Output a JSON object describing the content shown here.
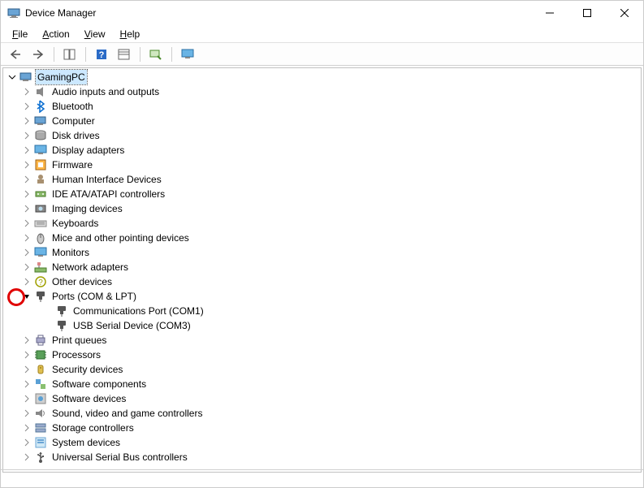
{
  "window": {
    "title": "Device Manager"
  },
  "menu": {
    "file": "File",
    "action": "Action",
    "view": "View",
    "help": "Help"
  },
  "tree": {
    "root": "GamingPC",
    "items": [
      {
        "label": "Audio inputs and outputs",
        "icon": "audio",
        "expanded": false
      },
      {
        "label": "Bluetooth",
        "icon": "bluetooth",
        "expanded": false
      },
      {
        "label": "Computer",
        "icon": "computer",
        "expanded": false
      },
      {
        "label": "Disk drives",
        "icon": "disk",
        "expanded": false
      },
      {
        "label": "Display adapters",
        "icon": "display",
        "expanded": false
      },
      {
        "label": "Firmware",
        "icon": "firmware",
        "expanded": false
      },
      {
        "label": "Human Interface Devices",
        "icon": "hid",
        "expanded": false
      },
      {
        "label": "IDE ATA/ATAPI controllers",
        "icon": "ide",
        "expanded": false
      },
      {
        "label": "Imaging devices",
        "icon": "imaging",
        "expanded": false
      },
      {
        "label": "Keyboards",
        "icon": "keyboard",
        "expanded": false
      },
      {
        "label": "Mice and other pointing devices",
        "icon": "mouse",
        "expanded": false
      },
      {
        "label": "Monitors",
        "icon": "monitor",
        "expanded": false
      },
      {
        "label": "Network adapters",
        "icon": "network",
        "expanded": false
      },
      {
        "label": "Other devices",
        "icon": "other",
        "expanded": false
      },
      {
        "label": "Ports (COM & LPT)",
        "icon": "port",
        "expanded": true,
        "children": [
          {
            "label": "Communications Port (COM1)",
            "icon": "port"
          },
          {
            "label": "USB Serial Device (COM3)",
            "icon": "port"
          }
        ]
      },
      {
        "label": "Print queues",
        "icon": "printer",
        "expanded": false
      },
      {
        "label": "Processors",
        "icon": "processor",
        "expanded": false
      },
      {
        "label": "Security devices",
        "icon": "security",
        "expanded": false
      },
      {
        "label": "Software components",
        "icon": "swcomp",
        "expanded": false
      },
      {
        "label": "Software devices",
        "icon": "swdev",
        "expanded": false
      },
      {
        "label": "Sound, video and game controllers",
        "icon": "sound",
        "expanded": false
      },
      {
        "label": "Storage controllers",
        "icon": "storage",
        "expanded": false
      },
      {
        "label": "System devices",
        "icon": "system",
        "expanded": false
      },
      {
        "label": "Universal Serial Bus controllers",
        "icon": "usb",
        "expanded": false
      }
    ]
  },
  "highlight_index": 14
}
